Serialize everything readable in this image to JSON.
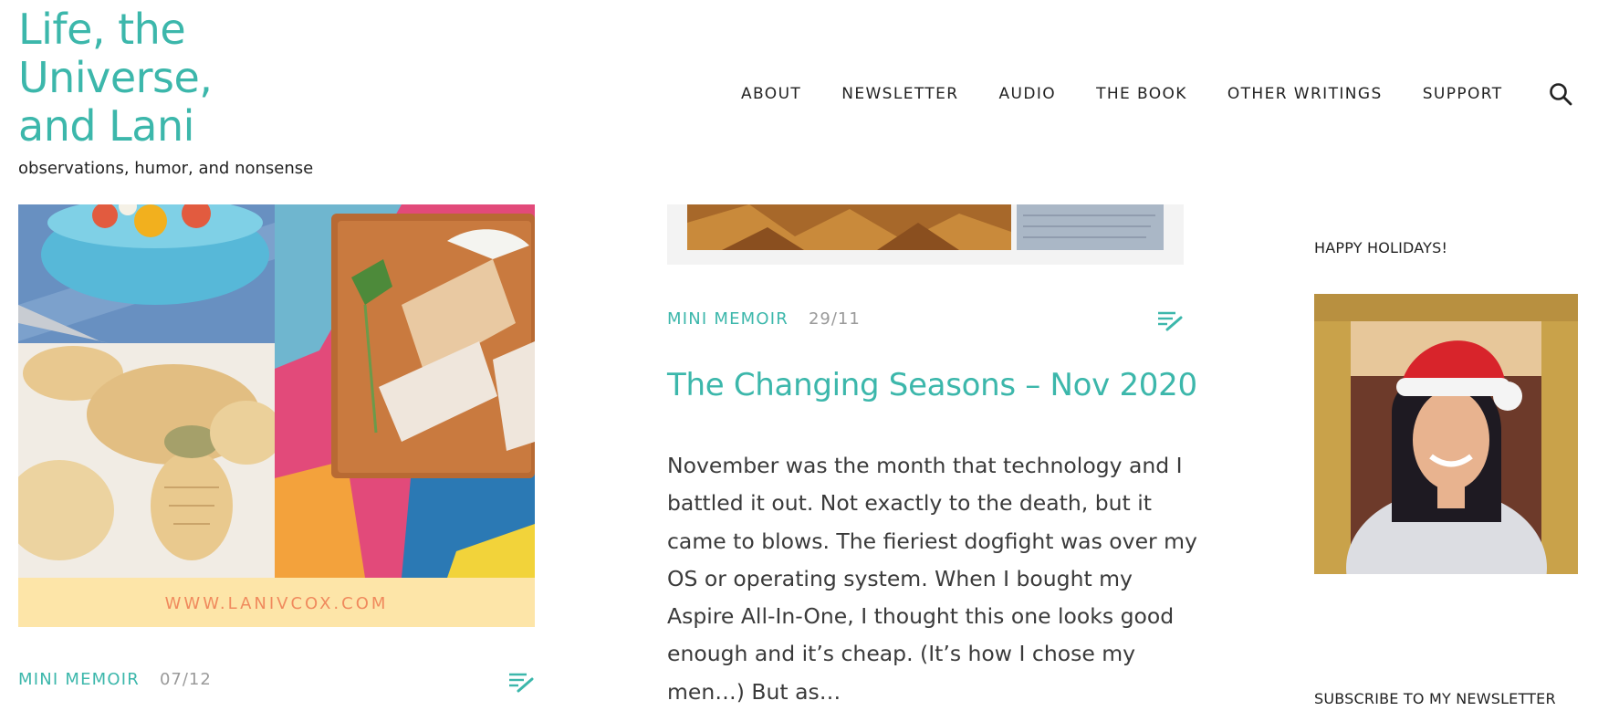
{
  "site": {
    "title": "Life, the Universe, and Lani",
    "tagline": "observations, humor, and nonsense"
  },
  "nav": {
    "items": [
      "ABOUT",
      "NEWSLETTER",
      "AUDIO",
      "THE BOOK",
      "OTHER WRITINGS",
      "SUPPORT"
    ],
    "search_icon": "search-icon"
  },
  "posts": [
    {
      "image_caption": "WWW.LANIVCOX.COM",
      "category": "MINI MEMOIR",
      "date": "07/12",
      "format_icon": "edit-lines-icon"
    },
    {
      "category": "MINI MEMOIR",
      "date": "29/11",
      "format_icon": "edit-lines-icon",
      "title": "The Changing Seasons – Nov 2020",
      "excerpt": "November was the month that technology and I battled it out. Not exactly to the death, but it came to blows. The fieriest dogfight was over my OS or operating system. When I bought my Aspire All-In-One, I thought this one looks good enough and it’s cheap. (It’s how I chose my men…) But as…"
    }
  ],
  "sidebar": {
    "widgets": [
      {
        "title": "HAPPY HOLIDAYS!"
      },
      {
        "title": "SUBSCRIBE TO MY NEWSLETTER"
      }
    ]
  },
  "colors": {
    "accent": "#3cb7ab",
    "text": "#222222",
    "muted": "#9a9a9a",
    "caption_band": "#fde5a8",
    "caption_text": "#f08a5d"
  }
}
